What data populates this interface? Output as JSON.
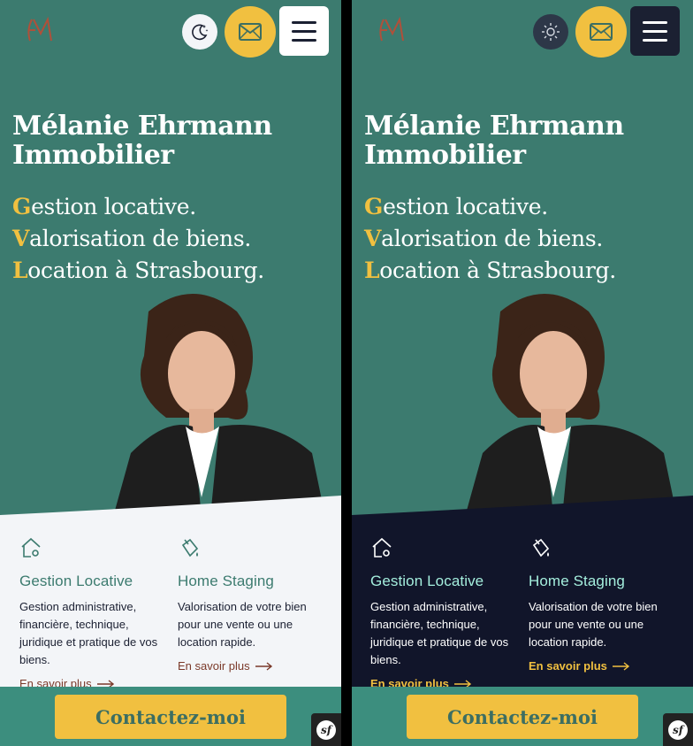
{
  "colors": {
    "teal": "#3c7b6f",
    "accent_yellow": "#f1c040",
    "light_section": "#f3f5f8",
    "dark_section": "#11152a",
    "navy": "#1b2032"
  },
  "header": {
    "logo_icon": "em-monogram-logo",
    "theme_icon_light_mode": "moon-stars-icon",
    "theme_icon_dark_mode": "sun-icon",
    "mail_icon": "envelope-icon",
    "menu_icon": "hamburger-icon"
  },
  "hero": {
    "title": "Mélanie Ehrmann Immobilier",
    "taglines": [
      {
        "initial": "G",
        "rest": "estion locative."
      },
      {
        "initial": "V",
        "rest": "alorisation de biens."
      },
      {
        "initial": "L",
        "rest": "ocation à Strasbourg."
      }
    ]
  },
  "services": [
    {
      "icon": "house-gear-icon",
      "title": "Gestion Locative",
      "description": "Gestion administrative, financière, technique, juridique et pratique de vos biens.",
      "link": "En savoir plus"
    },
    {
      "icon": "paint-bucket-icon",
      "title": "Home Staging",
      "description": "Valorisation de votre bien pour une vente ou une location rapide.",
      "link": "En savoir plus"
    }
  ],
  "cta": {
    "label": "Contactez-moi"
  },
  "badge": {
    "label": "sf",
    "icon": "symfony-toolbar-icon"
  }
}
